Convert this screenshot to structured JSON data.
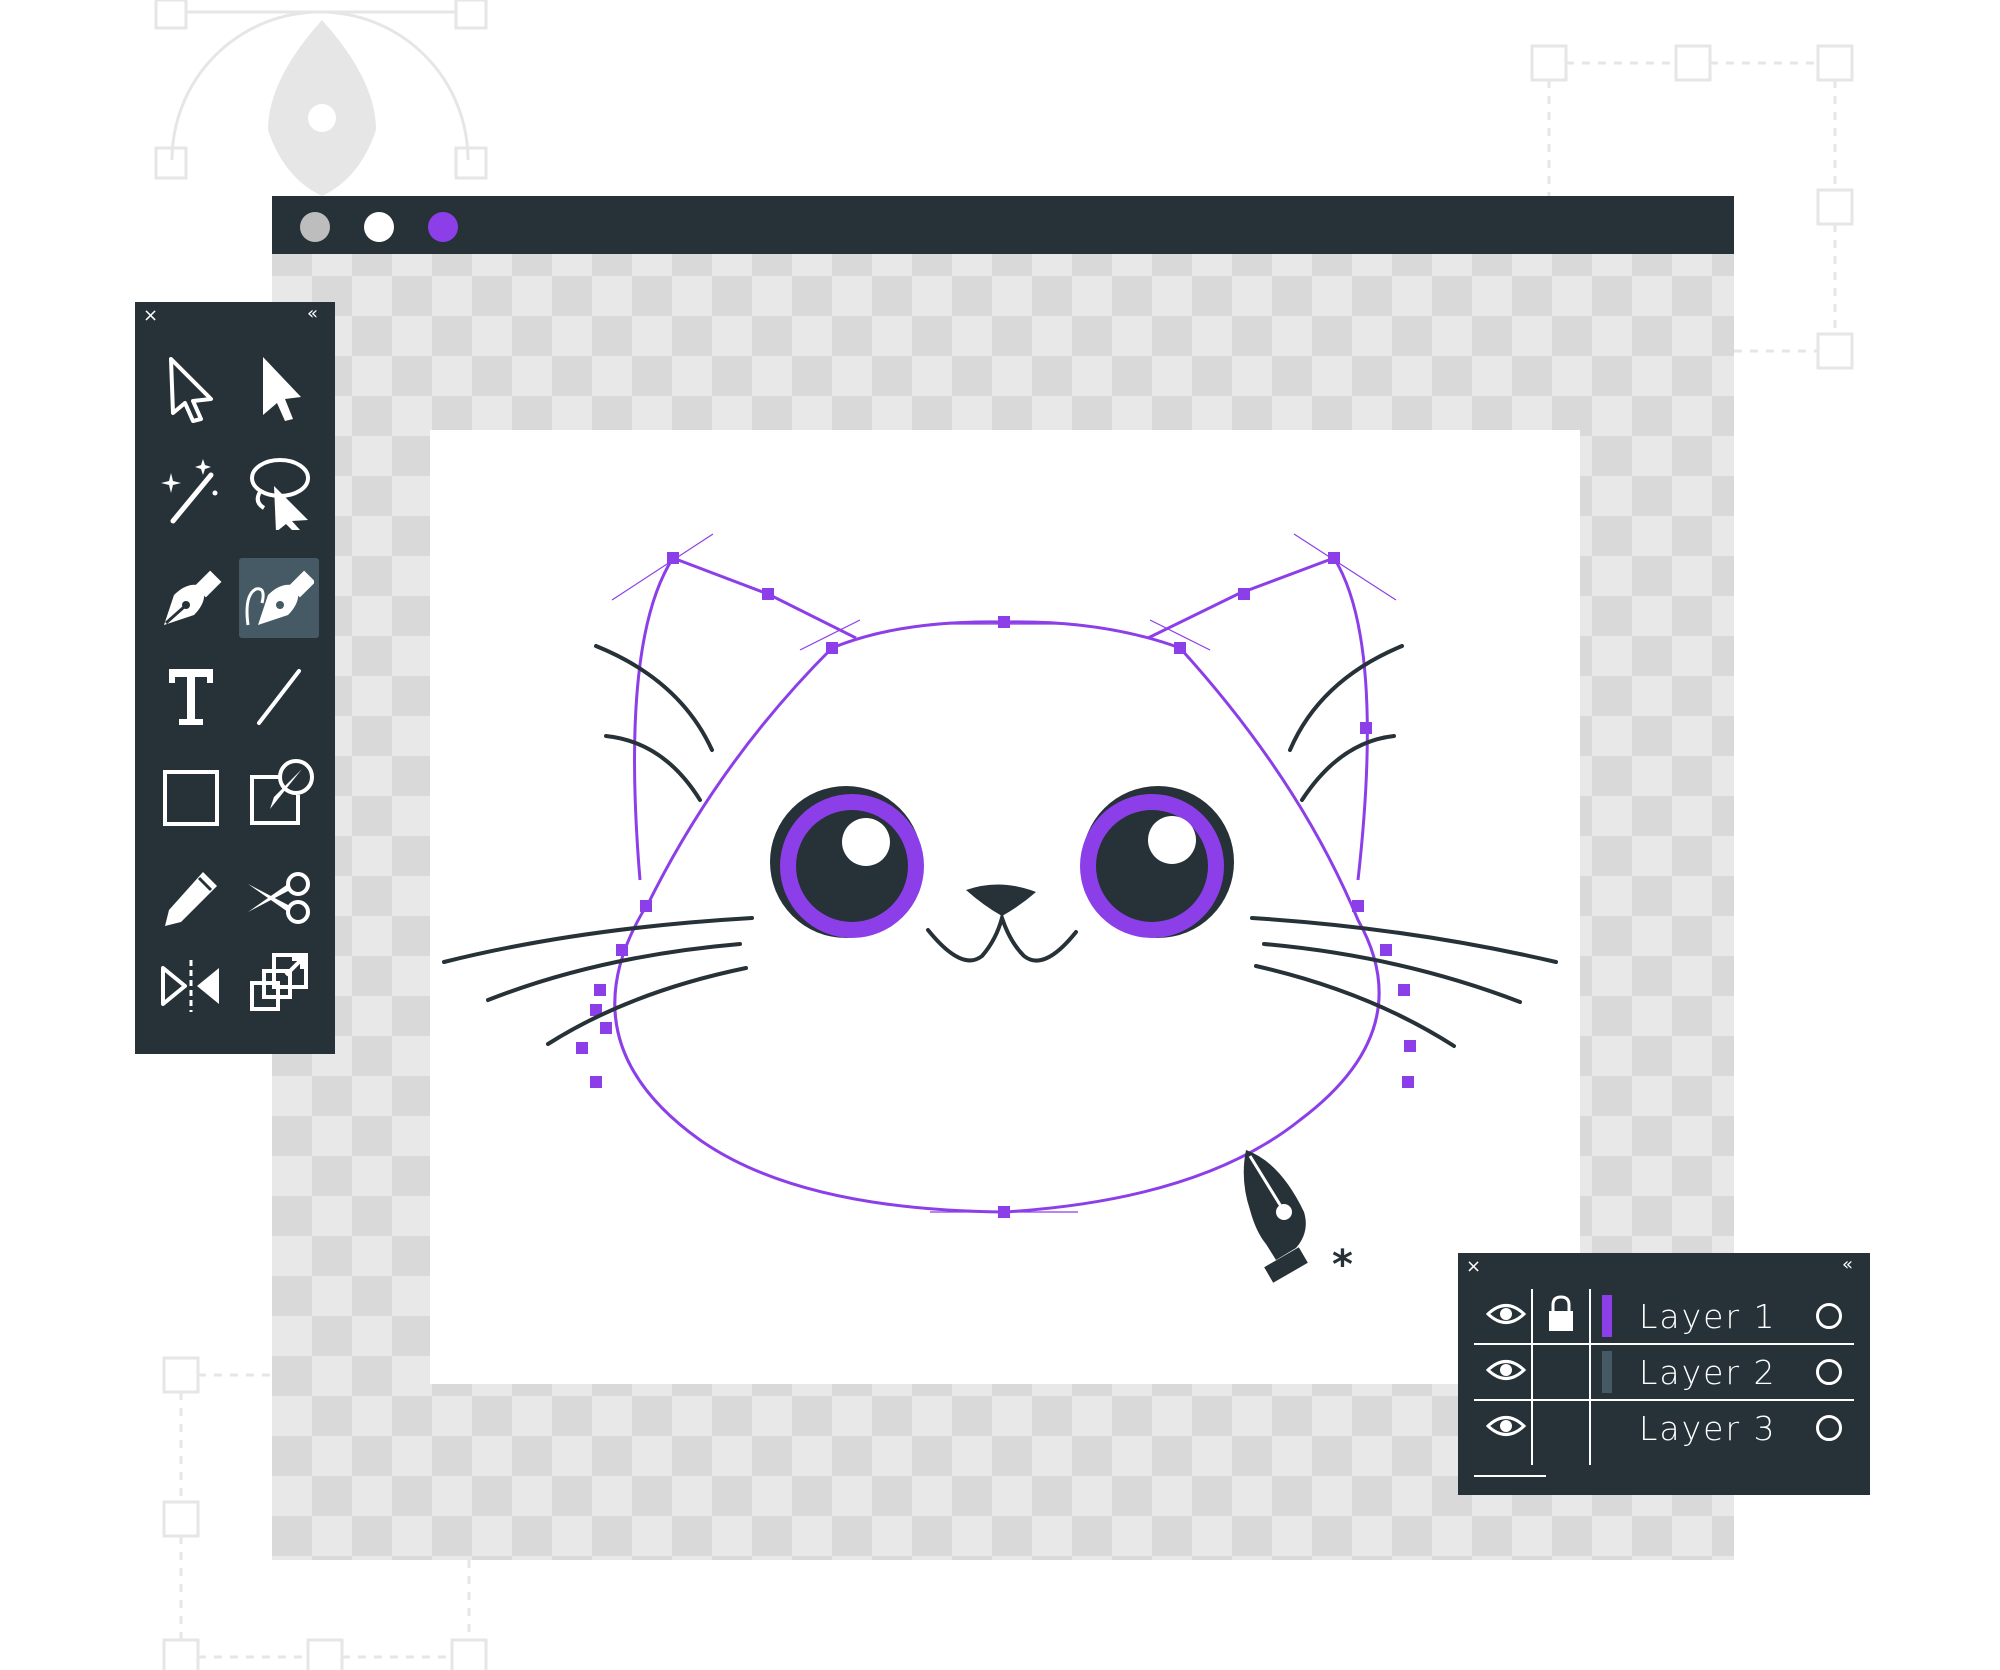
{
  "window": {
    "buttons": [
      {
        "name": "close",
        "color": "#bdbdbd"
      },
      {
        "name": "minimize",
        "color": "#ffffff"
      },
      {
        "name": "maximize",
        "color": "#8c3fe8"
      }
    ]
  },
  "theme": {
    "panel_bg": "#263238",
    "accent": "#8c3fe8",
    "checker_light": "#e8e8e8",
    "checker_dark": "#d9d9d9"
  },
  "tools_panel": {
    "close_icon": "×",
    "collapse_icon": "«",
    "tools": [
      {
        "name": "selection-tool",
        "icon": "arrow-outline-icon",
        "active": false
      },
      {
        "name": "direct-selection-tool",
        "icon": "arrow-filled-icon",
        "active": false
      },
      {
        "name": "magic-wand-tool",
        "icon": "magic-wand-icon",
        "active": false
      },
      {
        "name": "lasso-tool",
        "icon": "lasso-icon",
        "active": false
      },
      {
        "name": "pen-tool",
        "icon": "pen-nib-icon",
        "active": false
      },
      {
        "name": "curvature-pen-tool",
        "icon": "curvature-pen-icon",
        "active": true
      },
      {
        "name": "type-tool",
        "icon": "type-icon",
        "active": false
      },
      {
        "name": "line-tool",
        "icon": "line-icon",
        "active": false
      },
      {
        "name": "rectangle-tool",
        "icon": "rectangle-icon",
        "active": false
      },
      {
        "name": "shape-builder-tool",
        "icon": "paint-brush-square-icon",
        "active": false
      },
      {
        "name": "pencil-tool",
        "icon": "pencil-icon",
        "active": false
      },
      {
        "name": "scissors-tool",
        "icon": "scissors-icon",
        "active": false
      },
      {
        "name": "reflect-tool",
        "icon": "reflect-icon",
        "active": false
      },
      {
        "name": "scale-tool",
        "icon": "scale-icon",
        "active": false
      }
    ]
  },
  "layers_panel": {
    "close_icon": "×",
    "collapse_icon": "«",
    "layers": [
      {
        "name": "Layer 1",
        "visible": true,
        "locked": true,
        "color": "#8c3fe8"
      },
      {
        "name": "Layer 2",
        "visible": true,
        "locked": false,
        "color": "#455a64"
      },
      {
        "name": "Layer 3",
        "visible": true,
        "locked": false,
        "color": ""
      }
    ]
  },
  "cursor": {
    "icon": "pen-cursor-icon",
    "modifier": "*"
  }
}
